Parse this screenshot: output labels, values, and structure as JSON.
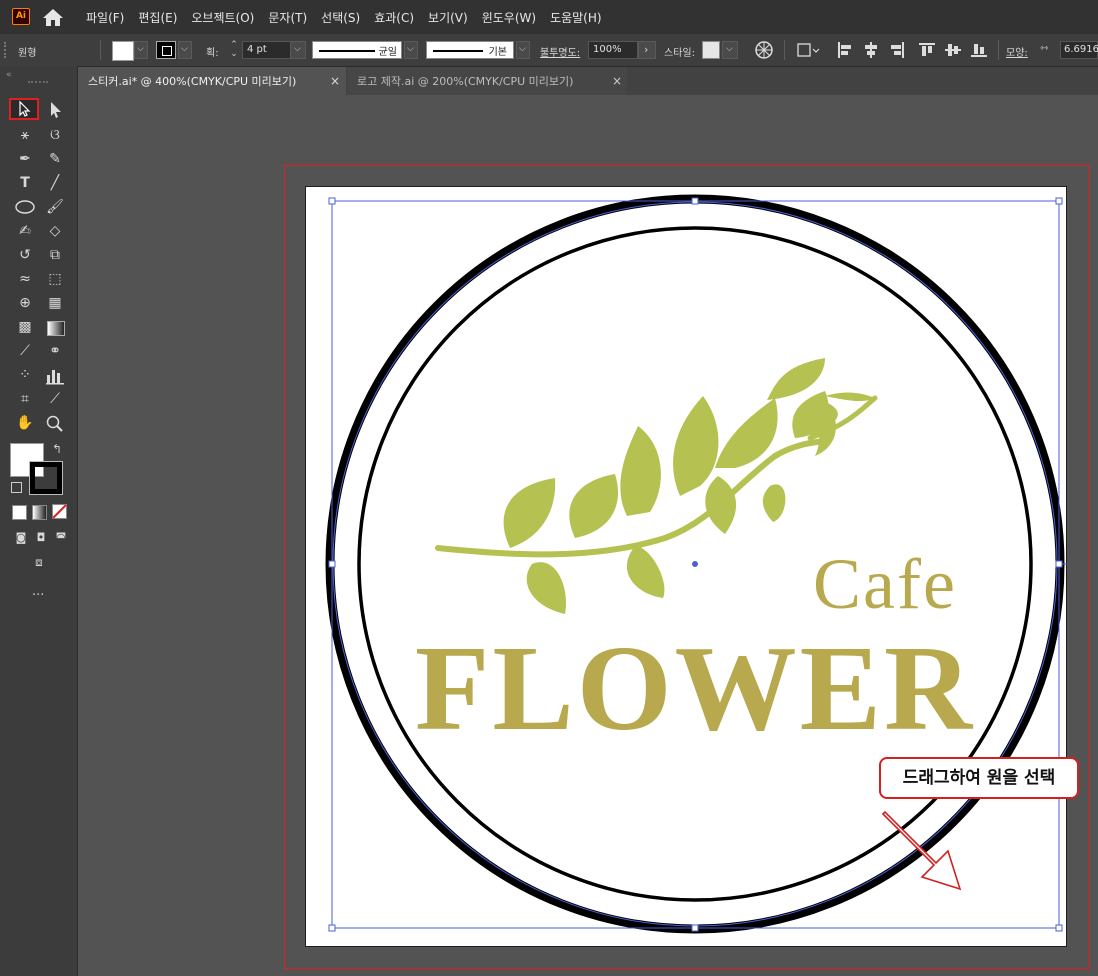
{
  "app": {
    "logo_text": "Ai"
  },
  "menu": [
    "파일(F)",
    "편집(E)",
    "오브젝트(O)",
    "문자(T)",
    "선택(S)",
    "효과(C)",
    "보기(V)",
    "윈도우(W)",
    "도움말(H)"
  ],
  "control_bar": {
    "object_type": "원형",
    "stroke_label": "획:",
    "stroke_weight": "4 pt",
    "profile_uniform": "균일",
    "brush_basic": "기본",
    "opacity_label": "불투명도:",
    "opacity_value": "100%",
    "style_label": "스타일:",
    "shape_label": "모양:",
    "width_value": "6.6916"
  },
  "tabs": [
    {
      "label": "스티커.ai* @ 400%(CMYK/CPU 미리보기)",
      "close": "×"
    },
    {
      "label": "로고 제작.ai @ 200%(CMYK/CPU 미리보기)",
      "close": "×"
    }
  ],
  "toolbar": {
    "more_label": "..."
  },
  "artwork": {
    "subtitle": "Cafe",
    "title": "FLOWER",
    "brand_color": "#b8a94e",
    "leaf_color": "#b5c150"
  },
  "callout": {
    "text": "드래그하여 원을 선택"
  },
  "colors": {
    "selection": "#4b5fd6",
    "annotation": "#d42020"
  }
}
